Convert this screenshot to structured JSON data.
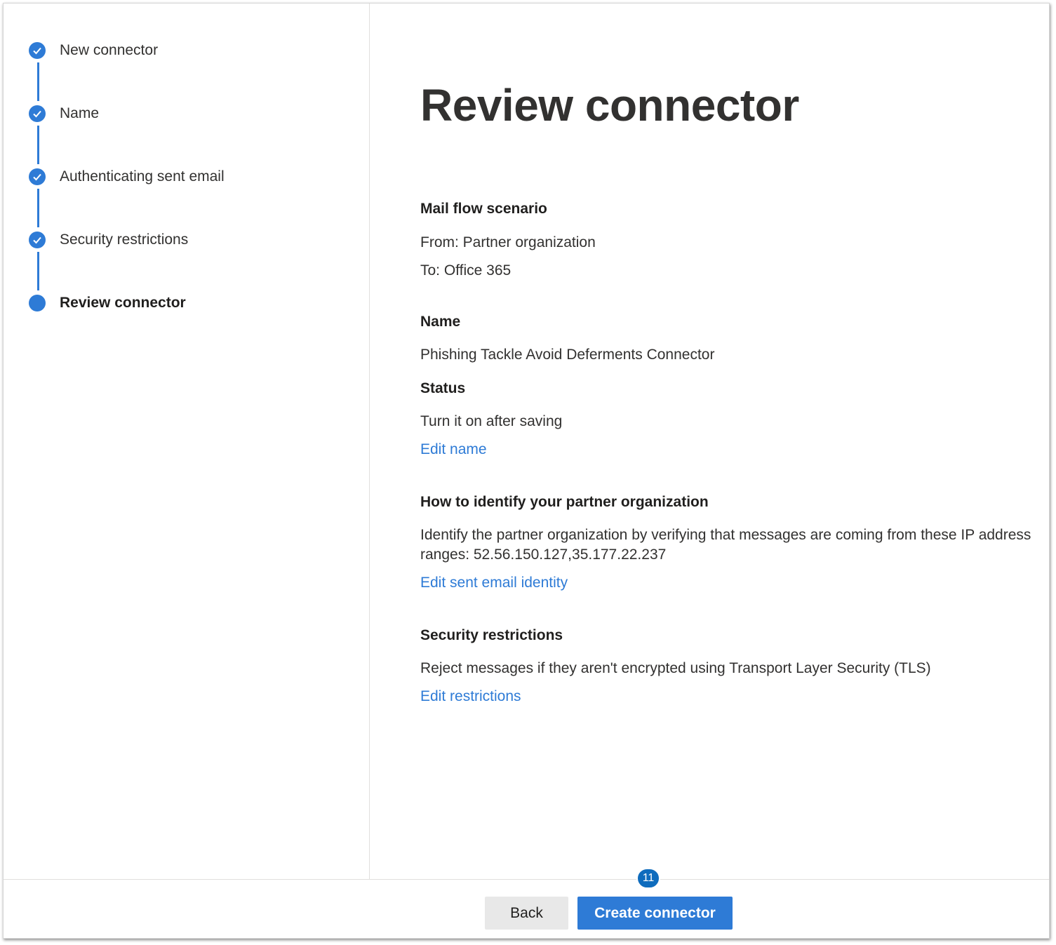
{
  "colors": {
    "accent": "#2e7bd6",
    "link": "#2e7bd6",
    "badge": "#0f6cbd"
  },
  "steps": [
    {
      "label": "New connector",
      "state": "completed",
      "icon": "checkmark-icon"
    },
    {
      "label": "Name",
      "state": "completed",
      "icon": "checkmark-icon"
    },
    {
      "label": "Authenticating sent email",
      "state": "completed",
      "icon": "checkmark-icon"
    },
    {
      "label": "Security restrictions",
      "state": "completed",
      "icon": "checkmark-icon"
    },
    {
      "label": "Review connector",
      "state": "current",
      "icon": "current-step-dot"
    }
  ],
  "main": {
    "title": "Review connector",
    "mail_flow": {
      "heading": "Mail flow scenario",
      "from": "From: Partner organization",
      "to": "To: Office 365"
    },
    "name_section": {
      "heading": "Name",
      "value": "Phishing Tackle Avoid Deferments Connector",
      "status_heading": "Status",
      "status_value": "Turn it on after saving",
      "edit_link": "Edit name"
    },
    "identify_section": {
      "heading": "How to identify your partner organization",
      "value": "Identify the partner organization by verifying that messages are coming from these IP address ranges: 52.56.150.127,35.177.22.237",
      "edit_link": "Edit sent email identity"
    },
    "security_section": {
      "heading": "Security restrictions",
      "value": "Reject messages if they aren't encrypted using Transport Layer Security (TLS)",
      "edit_link": "Edit restrictions"
    }
  },
  "footer": {
    "back_label": "Back",
    "create_label": "Create connector",
    "badge": "11"
  }
}
